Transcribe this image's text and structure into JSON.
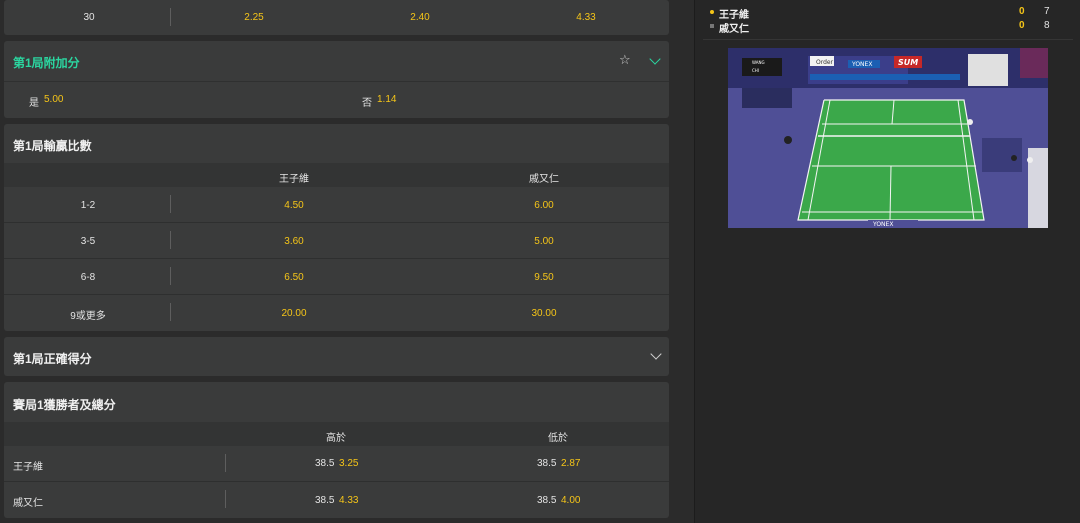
{
  "top_row": {
    "label": "30",
    "v1": "2.25",
    "v2": "2.40",
    "v3": "4.33"
  },
  "bonus": {
    "title": "第1局附加分",
    "yes_label": "是",
    "yes_odds": "5.00",
    "no_label": "否",
    "no_odds": "1.14"
  },
  "margin": {
    "title": "第1局輸贏比數",
    "col1": "王子維",
    "col2": "戚又仁",
    "rows": [
      {
        "label": "1-2",
        "a": "4.50",
        "b": "6.00"
      },
      {
        "label": "3-5",
        "a": "3.60",
        "b": "5.00"
      },
      {
        "label": "6-8",
        "a": "6.50",
        "b": "9.50"
      },
      {
        "label": "9或更多",
        "a": "20.00",
        "b": "30.00"
      }
    ]
  },
  "exact": {
    "title": "第1局正確得分"
  },
  "winner_total": {
    "title": "賽局1獲勝者及總分",
    "col1": "高於",
    "col2": "低於",
    "rows": [
      {
        "name": "王子維",
        "over_line": "38.5",
        "over_odds": "3.25",
        "under_line": "38.5",
        "under_odds": "2.87"
      },
      {
        "name": "戚又仁",
        "over_line": "38.5",
        "over_odds": "4.33",
        "under_line": "38.5",
        "under_odds": "4.00"
      }
    ]
  },
  "scoreboard": {
    "p1": {
      "name": "王子維",
      "game": "0",
      "points": "7"
    },
    "p2": {
      "name": "戚又仁",
      "game": "0",
      "points": "8"
    }
  },
  "video": {
    "overlay_p1": "WANG",
    "overlay_p2": "CHI",
    "banner1": "YONEX",
    "banner2": "SUM",
    "banner3": "Order",
    "court_brand": "YONEX"
  },
  "colors": {
    "accent_yellow": "#f5c518",
    "accent_teal": "#2bd6a0",
    "serve_dot": "#f5c518"
  }
}
